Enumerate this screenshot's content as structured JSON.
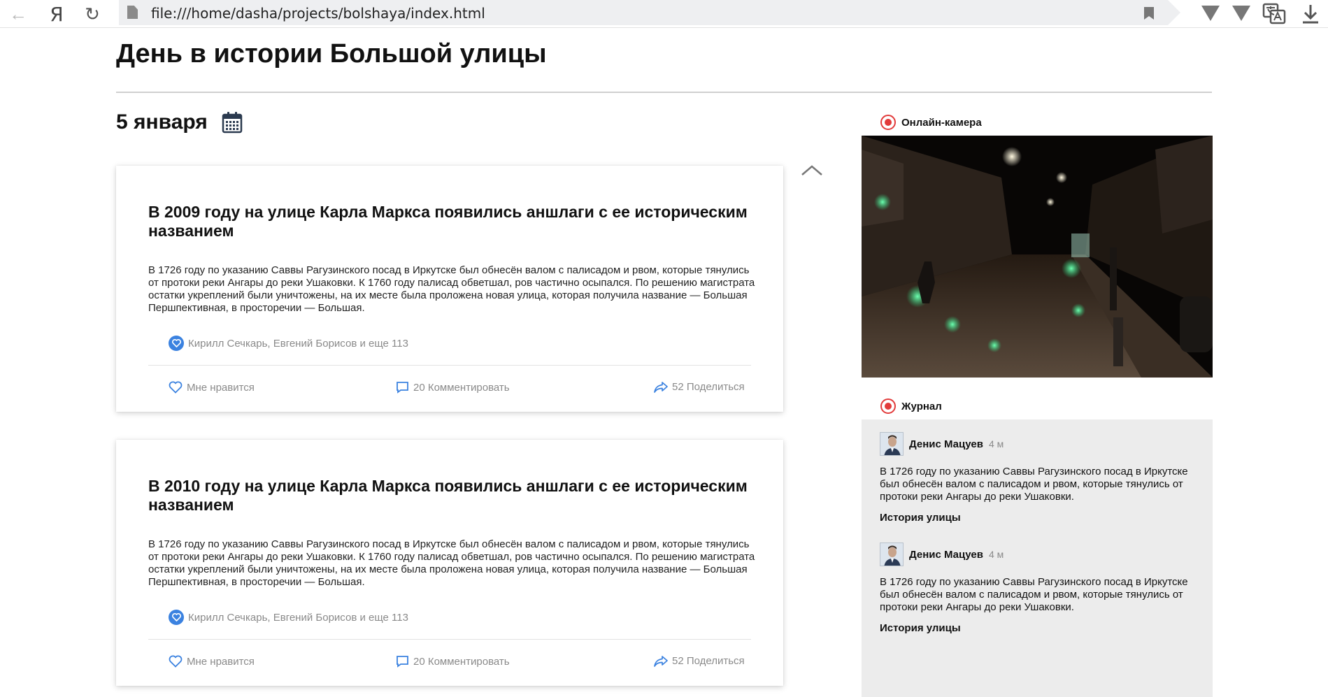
{
  "browser": {
    "yandex_label": "Я",
    "url": "file:///home/dasha/projects/bolshaya/index.html"
  },
  "page": {
    "title": "День в истории Большой улицы",
    "date": "5 января"
  },
  "posts": [
    {
      "title": "В 2009 году на улице Карла Маркса появились аншлаги с ее историческим названием",
      "body": "В 1726 году по указанию Саввы Рагузинского посад в Иркутске был обнесён валом с палисадом и рвом, которые тянулись от протоки реки Ангары до реки Ушаковки. К 1760 году палисад обветшал, ров частично осыпался. По решению магистрата остатки укреплений были уничтожены, на их месте была проложена новая улица, которая получила название — Большая Першпективная, в просторечии — Большая.",
      "likers": "Кирилл Сечкарь, Евгений Борисов и еще 113",
      "like_label": "Мне нравится",
      "comment_label": "20 Комментировать",
      "share_label": "52 Поделиться"
    },
    {
      "title": "В 2010 году на улице Карла Маркса появились аншлаги с ее историческим названием",
      "body": "В 1726 году по указанию Саввы Рагузинского посад в Иркутске был обнесён валом с палисадом и рвом, которые тянулись от протоки реки Ангары до реки Ушаковки. К 1760 году палисад обветшал, ров частично осыпался. По решению магистрата остатки укреплений были уничтожены, на их месте была проложена новая улица, которая получила название — Большая Першпективная, в просторечии — Большая.",
      "likers": "Кирилл Сечкарь, Евгений Борисов и еще 113",
      "like_label": "Мне нравится",
      "comment_label": "20 Комментировать",
      "share_label": "52 Поделиться"
    }
  ],
  "sidebar": {
    "camera_label": "Онлайн-камера",
    "journal_label": "Журнал",
    "journal": [
      {
        "author": "Денис Мацуев",
        "time": "4 м",
        "text": "В 1726 году по указанию Саввы Рагузинского посад в Иркутске был обнесён валом с палисадом и рвом, которые тянулись от протоки реки Ангары до реки Ушаковки.",
        "tag": "История улицы"
      },
      {
        "author": "Денис Мацуев",
        "time": "4 м",
        "text": "В 1726 году по указанию Саввы Рагузинского посад в Иркутске был обнесён валом с палисадом и рвом, которые тянулись от протоки реки Ангары до реки Ушаковки.",
        "tag": "История улицы"
      }
    ]
  },
  "colors": {
    "accent_blue": "#3b82e0",
    "record_red": "#e23b3b",
    "muted_text": "#8a8a8a",
    "journal_bg": "#ececec"
  }
}
